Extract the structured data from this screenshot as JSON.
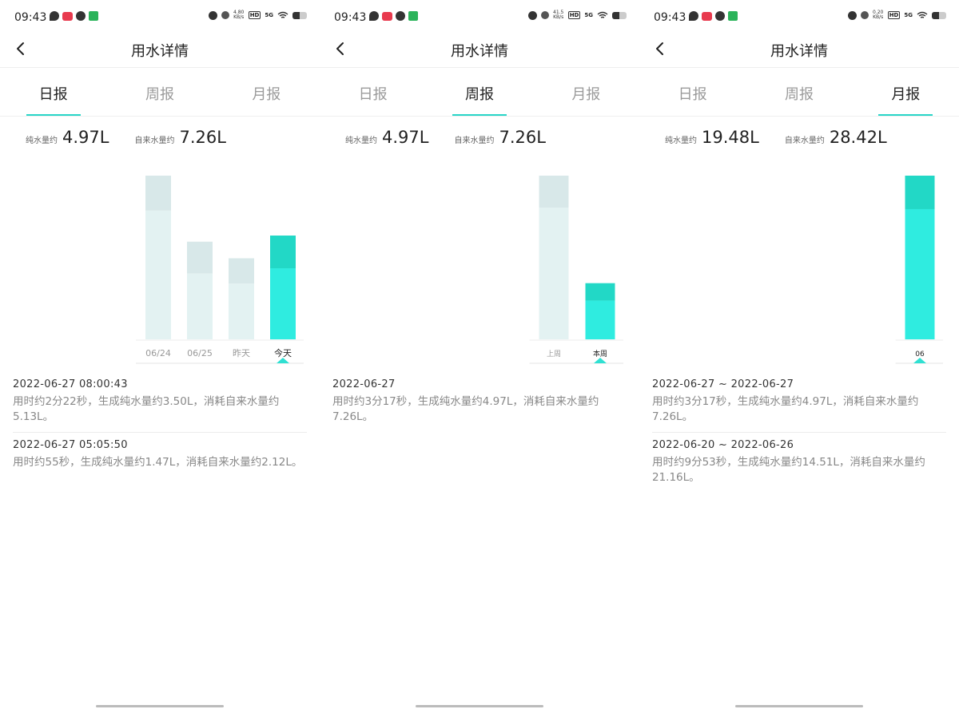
{
  "screens": [
    {
      "status": {
        "time": "09:43",
        "net_speed_value": "4.80",
        "net_speed_unit": "KB/s",
        "hd": "HD",
        "signal": "5G"
      },
      "nav": {
        "title": "用水详情"
      },
      "tabs": [
        {
          "label": "日报",
          "active": true
        },
        {
          "label": "周报",
          "active": false
        },
        {
          "label": "月报",
          "active": false
        }
      ],
      "summary": {
        "pure_label": "纯水量约",
        "pure_value": "4.97L",
        "tap_label": "自来水量约",
        "tap_value": "7.26L"
      },
      "chart_data": {
        "type": "bar",
        "categories": [
          "06/24",
          "06/25",
          "昨天",
          "今天"
        ],
        "selected_index": 3,
        "series": [
          {
            "values": [
              11.45,
              6.83,
              5.67,
              7.26
            ]
          },
          {
            "values": [
              9.0,
              4.6,
              3.9,
              4.97
            ]
          }
        ],
        "colors": {
          "inactive_top": "#d8e8e9",
          "inactive_bottom": "#e3f2f2",
          "active_top": "#22d8c6",
          "active_bottom": "#2fece0",
          "marker": "#2fe0d2"
        }
      },
      "records": [
        {
          "date": "2022-06-27 08:00:43",
          "desc": "用时约2分22秒，生成纯水量约3.50L，消耗自来水量约5.13L。"
        },
        {
          "date": "2022-06-27 05:05:50",
          "desc": "用时约55秒，生成纯水量约1.47L，消耗自来水量约2.12L。"
        }
      ]
    },
    {
      "status": {
        "time": "09:43",
        "net_speed_value": "41.5",
        "net_speed_unit": "KB/s",
        "hd": "HD",
        "signal": "5G"
      },
      "nav": {
        "title": "用水详情"
      },
      "tabs": [
        {
          "label": "日报",
          "active": false
        },
        {
          "label": "周报",
          "active": true
        },
        {
          "label": "月报",
          "active": false
        }
      ],
      "summary": {
        "pure_label": "纯水量约",
        "pure_value": "4.97L",
        "tap_label": "自来水量约",
        "tap_value": "7.26L"
      },
      "chart_data": {
        "type": "bar",
        "categories": [
          "上周",
          "本周"
        ],
        "selected_index": 1,
        "series": [
          {
            "values": [
              21.16,
              7.26
            ]
          },
          {
            "values": [
              17.0,
              5.0
            ]
          }
        ],
        "colors": {
          "inactive_top": "#d8e8e9",
          "inactive_bottom": "#e3f2f2",
          "active_top": "#22d8c6",
          "active_bottom": "#2fece0",
          "marker": "#2fe0d2"
        }
      },
      "records": [
        {
          "date": "2022-06-27",
          "desc": "用时约3分17秒，生成纯水量约4.97L，消耗自来水量约7.26L。"
        }
      ]
    },
    {
      "status": {
        "time": "09:43",
        "net_speed_value": "0.20",
        "net_speed_unit": "KB/s",
        "hd": "HD",
        "signal": "5G"
      },
      "nav": {
        "title": "用水详情"
      },
      "tabs": [
        {
          "label": "日报",
          "active": false
        },
        {
          "label": "周报",
          "active": false
        },
        {
          "label": "月报",
          "active": true
        }
      ],
      "summary": {
        "pure_label": "纯水量约",
        "pure_value": "19.48L",
        "tap_label": "自来水量约",
        "tap_value": "28.42L"
      },
      "chart_data": {
        "type": "bar",
        "categories": [
          "06"
        ],
        "selected_index": 0,
        "series": [
          {
            "values": [
              28.42
            ]
          },
          {
            "values": [
              22.6
            ]
          }
        ],
        "colors": {
          "inactive_top": "#d8e8e9",
          "inactive_bottom": "#e3f2f2",
          "active_top": "#22d8c6",
          "active_bottom": "#2fece0",
          "marker": "#2fe0d2"
        }
      },
      "records": [
        {
          "date": "2022-06-27 ~ 2022-06-27",
          "desc": "用时约3分17秒，生成纯水量约4.97L，消耗自来水量约7.26L。"
        },
        {
          "date": "2022-06-20 ~ 2022-06-26",
          "desc": "用时约9分53秒，生成纯水量约14.51L，消耗自来水量约21.16L。"
        }
      ]
    }
  ]
}
